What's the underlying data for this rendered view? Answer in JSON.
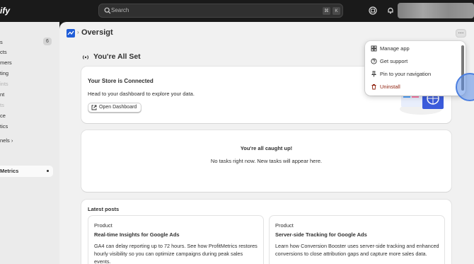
{
  "topbar": {
    "brand": "ify",
    "search_placeholder": "Search",
    "shortcut_key1": "⌘",
    "shortcut_key2": "K"
  },
  "sidebar": {
    "items": [
      {
        "label": "s",
        "badge": "6"
      },
      {
        "label": "cts"
      },
      {
        "label": "mers"
      },
      {
        "label": "ting"
      },
      {
        "label": "ints",
        "dim": true
      },
      {
        "label": "nt"
      },
      {
        "label": "ts",
        "dim": true
      },
      {
        "label": "ce"
      },
      {
        "label": "tics"
      },
      {
        "label": "nels ›"
      }
    ],
    "active_item": "Metrics"
  },
  "app_header": {
    "title": "Oversigt",
    "separator": "›",
    "more_label": "⋯"
  },
  "status_section": {
    "title": "You're All Set"
  },
  "store_card": {
    "title": "Your Store is Connected",
    "subtitle": "Head to your dashboard to explore your data.",
    "button_label": "Open Dashboard"
  },
  "tasks_card": {
    "title": "You're all caught up!",
    "subtitle": "No tasks right now. New tasks will appear here."
  },
  "posts_card": {
    "title": "Latest posts",
    "posts": [
      {
        "category": "Product",
        "title": "Real-time Insights for Google Ads",
        "body": "GA4 can delay reporting up to 72 hours. See how ProfitMetrics restores hourly visibility so you can optimize campaigns during peak sales events."
      },
      {
        "category": "Product",
        "title": "Server-side Tracking for Google Ads",
        "body": "Learn how Conversion Booster uses server-side tracking and enhanced conversions to close attribution gaps and capture more sales data."
      }
    ]
  },
  "dropdown": {
    "items": [
      {
        "label": "Manage app",
        "icon": "settings-icon"
      },
      {
        "label": "Get support",
        "icon": "question-icon"
      },
      {
        "label": "Pin to your navigation",
        "icon": "pin-icon"
      },
      {
        "label": "Uninstall",
        "icon": "trash-icon",
        "danger": true
      }
    ]
  },
  "colors": {
    "topbar_bg": "#1a1a1a",
    "main_bg": "#f1f1f1",
    "app_logo": "#1f5dd8",
    "danger": "#8e1f0b"
  }
}
